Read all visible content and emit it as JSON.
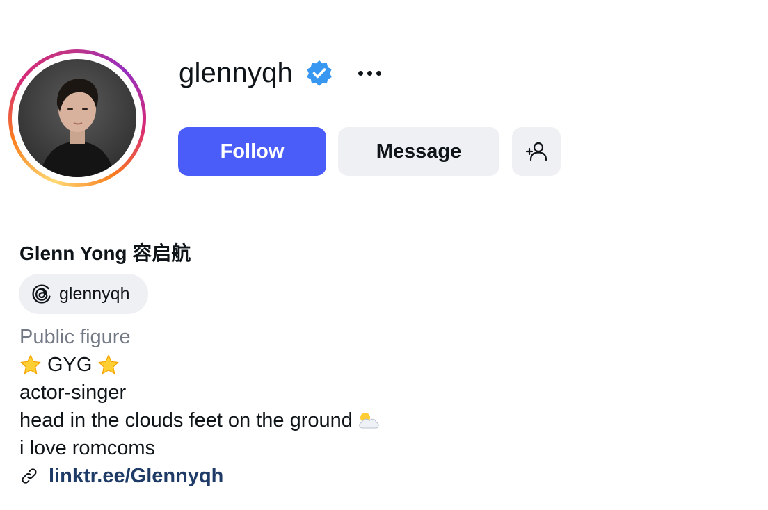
{
  "profile": {
    "username": "glennyqh",
    "verified": true,
    "full_name": "Glenn Yong 容启航",
    "threads_handle": "glennyqh",
    "category": "Public figure",
    "bio_line_1_text": "GYG",
    "bio_line_2": "actor-singer",
    "bio_line_3_text": "head in the clouds feet on the ground",
    "bio_line_4": "i love romcoms",
    "link": "linktr.ee/Glennyqh"
  },
  "actions": {
    "follow_label": "Follow",
    "message_label": "Message"
  },
  "icons": {
    "verified": "verified-badge-icon",
    "more": "more-options-icon",
    "add_user": "add-user-icon",
    "threads": "threads-logo-icon",
    "link": "link-icon",
    "star": "star-emoji-icon",
    "cloud": "sun-behind-cloud-emoji-icon"
  },
  "colors": {
    "follow_button": "#4a5df9",
    "secondary_button": "#eff0f3",
    "verified_badge": "#3897f0",
    "category_text": "#737a85",
    "link_text": "#1e3a66"
  }
}
